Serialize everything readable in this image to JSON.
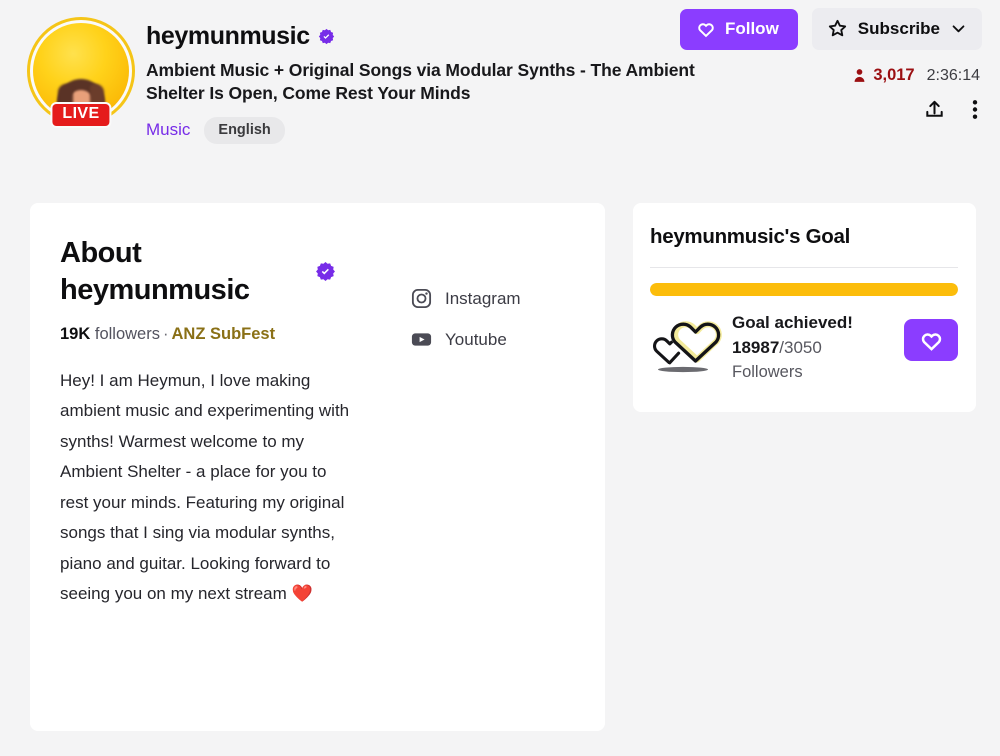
{
  "header": {
    "channel_name": "heymunmusic",
    "verified_icon": "verified-badge-icon",
    "live_badge": "LIVE",
    "stream_title": "Ambient Music + Original Songs via Modular Synths - The Ambient Shelter Is Open, Come Rest Your Minds",
    "category": "Music",
    "language_tag": "English",
    "follow_label": "Follow",
    "follow_icon": "heart-icon",
    "subscribe_label": "Subscribe",
    "subscribe_icon": "star-icon",
    "subscribe_chevron_icon": "chevron-down-icon",
    "viewer_count": "3,017",
    "viewer_icon": "viewer-person-icon",
    "uptime": "2:36:14",
    "share_icon": "share-upload-icon",
    "more_icon": "more-vertical-icon",
    "accent_purple": "#8b3dff",
    "live_red": "#e51b1b",
    "viewer_red": "#9b0f12"
  },
  "about": {
    "title": "About heymunmusic",
    "verified_icon": "verified-badge-icon",
    "followers_count": "19K",
    "followers_label": "followers",
    "separator": "·",
    "event": "ANZ SubFest",
    "event_color": "#8a7016",
    "bio": "Hey! I am Heymun, I love making ambient music and experimenting with synths! Warmest welcome to my Ambient Shelter - a place for you to rest your minds. Featuring my original songs that I sing via modular synths, piano and guitar. Looking forward to seeing you on my next stream ❤️",
    "socials": [
      {
        "label": "Instagram",
        "icon": "instagram-icon"
      },
      {
        "label": "Youtube",
        "icon": "youtube-icon"
      }
    ]
  },
  "goal": {
    "title": "heymunmusic's Goal",
    "progress_percent": 100,
    "progress_color": "#fcbd0b",
    "status": "Goal achieved!",
    "current": "18987",
    "divider": "/",
    "target": "3050",
    "unit": "Followers",
    "icon": "two-hearts-icon",
    "button_icon": "heart-icon",
    "button_color": "#8b3dff"
  }
}
